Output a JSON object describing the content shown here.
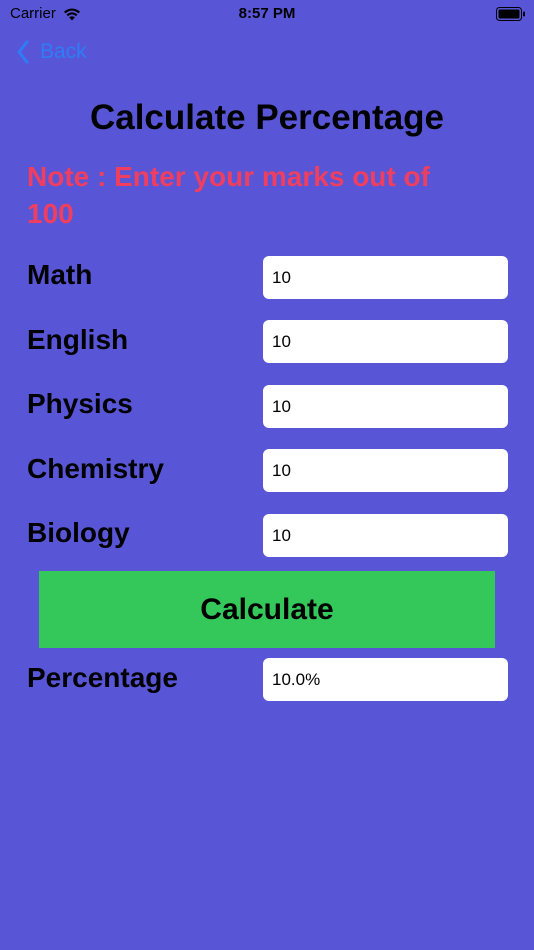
{
  "status_bar": {
    "carrier": "Carrier",
    "time": "8:57 PM",
    "wifi_icon": "wifi-icon",
    "battery_icon": "battery-icon"
  },
  "nav": {
    "back_label": "Back",
    "back_icon": "chevron-left-icon"
  },
  "title": "Calculate Percentage",
  "note": "Note :  Enter your marks out of 100",
  "subjects": [
    {
      "label": "Math",
      "value": "10"
    },
    {
      "label": "English",
      "value": "10"
    },
    {
      "label": "Physics",
      "value": "10"
    },
    {
      "label": "Chemistry",
      "value": "10"
    },
    {
      "label": "Biology",
      "value": "10"
    }
  ],
  "calculate_label": "Calculate",
  "result": {
    "label": "Percentage",
    "value": "10.0%"
  },
  "colors": {
    "background": "#5856D6",
    "note": "#F03E60",
    "button": "#34C75A",
    "back": "#2F7CF6"
  }
}
